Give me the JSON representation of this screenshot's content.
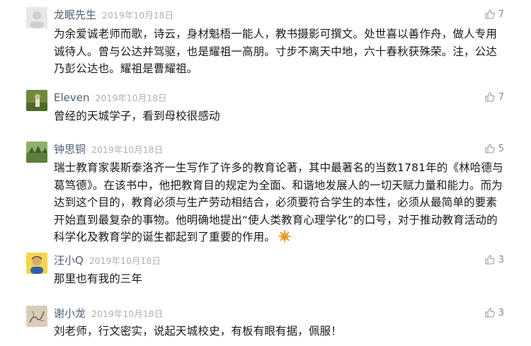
{
  "comments": [
    {
      "author": "龙眠先生",
      "date": "2019年10月18日",
      "likes": "7",
      "text": "为余爱诚老师而歌，诗云，身材魁梧一能人，教书摄影可撰文。处世喜以善作舟，做人专用诚待人。曾与公达并驾驱，也是耀祖一高朋。寸步不离天中地，六十春秋获殊荣。注，公达乃彭公达也。耀祖是曹耀祖。"
    },
    {
      "author": "Eleven",
      "date": "2019年10月18日",
      "likes": "7",
      "text": "曾经的天城学子，看到母校很感动"
    },
    {
      "author": "钟思铜",
      "date": "2019年10月18日",
      "likes": "5",
      "text": "瑞士教育家裴斯泰洛齐一生写作了许多的教育论著，其中最著名的当数1781年的《林哈德与葛笃德》。在该书中，他把教育目的规定为全面、和谐地发展人的一切天赋力量和能力。而为达到这个目的，教育必须与生产劳动相结合，必须要符合学生的本性，必须从最简单的要素开始直到最复杂的事物。他明确地提出“使人类教育心理学化”的口号，对于推动教育活动的科学化及教育学的诞生都起到了重要的作用。",
      "emoji": "sun-icon"
    },
    {
      "author": "汪小Q",
      "date": "2019年10月18日",
      "likes": "3",
      "text": "那里也有我的三年"
    },
    {
      "author": "谢小龙",
      "date": "2019年10月18日",
      "likes": "3",
      "text": "刘老师，行文密实，说起天城校史，有板有眼有据，佩服！"
    }
  ],
  "colors": {
    "author": "#4e5e76",
    "date": "#b0b0b0",
    "text": "#1a1a1a",
    "like": "#888888",
    "divider": "#eeeeee"
  }
}
